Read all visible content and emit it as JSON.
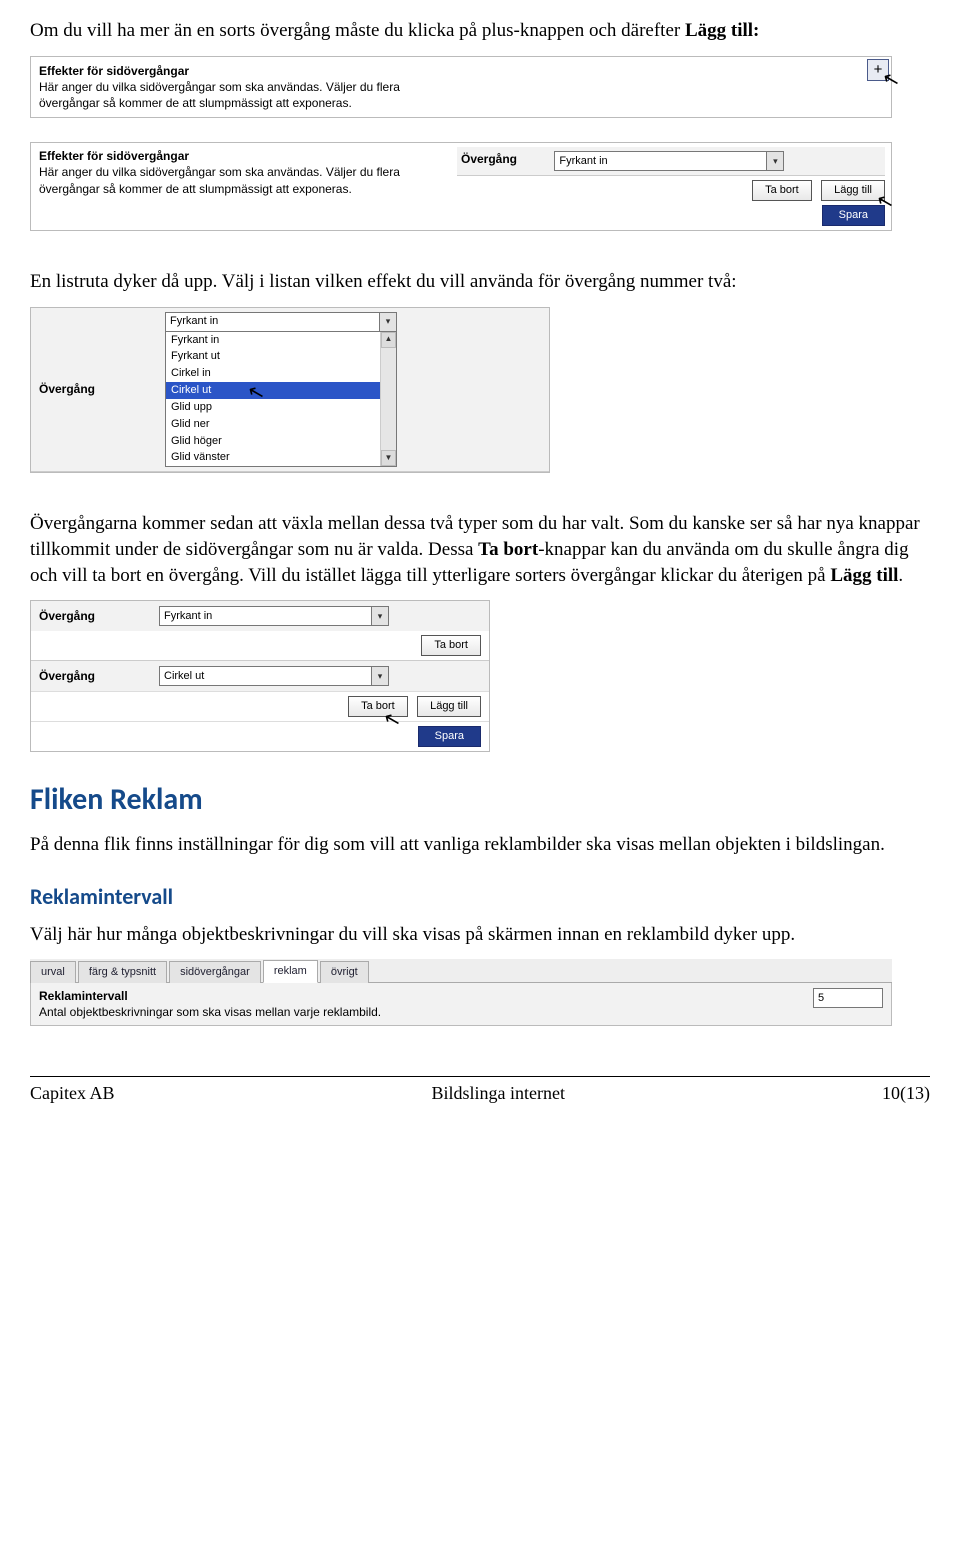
{
  "p1": "Om du vill ha mer än en sorts övergång måste du klicka på plus-knappen och därefter ",
  "p1b": "Lägg till:",
  "panel1": {
    "title": "Effekter för sidövergångar",
    "desc": "Här anger du vilka sidövergångar som ska användas. Väljer du flera övergångar så kommer de att slumpmässigt att exponeras.",
    "plus": "+"
  },
  "panel2": {
    "title": "Effekter för sidövergångar",
    "desc": "Här anger du vilka sidövergångar som ska användas. Väljer du flera övergångar så kommer de att slumpmässigt att exponeras.",
    "lbl_overgang": "Övergång",
    "combo_value": "Fyrkant in",
    "btn_remove": "Ta bort",
    "btn_add": "Lägg till",
    "btn_save": "Spara"
  },
  "p2": "En listruta dyker då upp. Välj i listan vilken effekt du vill använda för övergång nummer två:",
  "panel3": {
    "lbl_overgang": "Övergång",
    "combo_value": "Fyrkant in",
    "options": [
      "Fyrkant in",
      "Fyrkant ut",
      "Cirkel in",
      "Cirkel ut",
      "Glid upp",
      "Glid ner",
      "Glid höger",
      "Glid vänster"
    ],
    "selected": "Cirkel ut"
  },
  "p3a": "Övergångarna kommer sedan att växla mellan dessa två typer som du har valt. Som du kanske ser så har nya knappar tillkommit under de sidövergångar som nu är valda. Dessa ",
  "p3b": "Ta bort",
  "p3c": "-knappar kan du använda om du skulle ångra dig och vill ta bort en övergång. Vill du istället lägga till ytterligare sorters övergångar klickar du återigen på ",
  "p3d": "Lägg till",
  "p3e": ".",
  "panel4": {
    "lbl_overgang": "Övergång",
    "combo1": "Fyrkant in",
    "combo2": "Cirkel ut",
    "btn_remove": "Ta bort",
    "btn_add": "Lägg till",
    "btn_save": "Spara"
  },
  "h_reklam": "Fliken Reklam",
  "p4": "På denna flik finns inställningar för dig som vill att vanliga reklambilder ska visas mellan objekten i bildslingan.",
  "h_reklamintervall": "Reklamintervall",
  "p5": "Välj här hur många objektbeskrivningar du vill ska visas på skärmen innan en reklambild dyker upp.",
  "tabs": [
    "urval",
    "färg & typsnitt",
    "sidövergångar",
    "reklam",
    "övrigt"
  ],
  "active_tab": "reklam",
  "settings": {
    "title": "Reklamintervall",
    "desc": "Antal objektbeskrivningar som ska visas mellan varje reklambild.",
    "value": "5"
  },
  "footer": {
    "left": "Capitex AB",
    "center": "Bildslinga internet",
    "right": "10(13)"
  },
  "cursor": "↖"
}
